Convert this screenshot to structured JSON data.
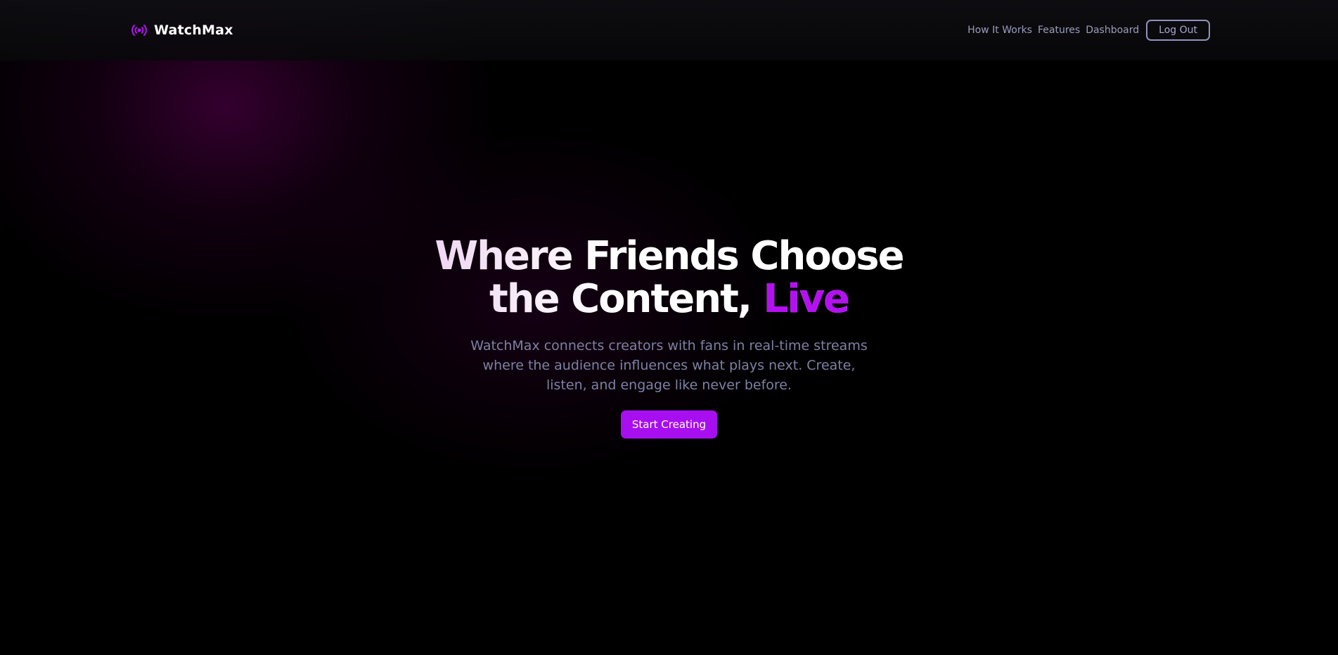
{
  "brand": {
    "name": "WatchMax",
    "icon": "broadcast-icon",
    "accent_color": "#b410f2"
  },
  "nav": {
    "links": [
      "How It Works",
      "Features",
      "Dashboard"
    ],
    "logout_label": "Log Out"
  },
  "hero": {
    "headline_main": "Where Friends Choose the Content,",
    "headline_accent": "Live",
    "subtitle": "WatchMax connects creators with fans in real-time streams where the audience influences what plays next. Create, listen, and engage like never before.",
    "cta_label": "Start Creating",
    "cta_color": "#a80ff0"
  }
}
